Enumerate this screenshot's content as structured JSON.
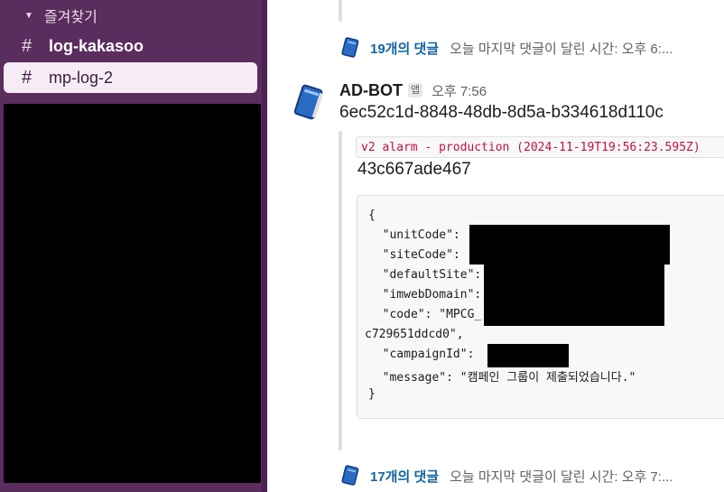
{
  "sidebar": {
    "section_label": "즐겨찾기",
    "channels": [
      {
        "hash": "#",
        "name": "log-kakasoo",
        "state": "unread"
      },
      {
        "hash": "#",
        "name": "mp-log-2",
        "state": "selected"
      }
    ]
  },
  "messages": {
    "thread_top": {
      "reply_count": "19개의 댓글",
      "last_reply": "오늘 마지막 댓글이 달린 시간: 오후 6:..."
    },
    "bot_message": {
      "sender": "AD-BOT",
      "badge": "앱",
      "time": "오후 7:56",
      "text": "6ec52c1d-8848-48db-8d5a-b334618d110c",
      "attachment": {
        "title_code": "v2 alarm - production (2024-11-19T19:56:23.595Z)",
        "subtitle": "43c667ade467",
        "code_lines": [
          "{",
          "  \"unitCode\":",
          "  \"siteCode\":",
          "  \"defaultSite\":",
          "  \"imwebDomain\":",
          "  \"code\": \"MPCG_",
          "c729651ddcd0\",",
          "  \"campaignId\":",
          "  \"message\": \"캠페인 그룹이 제출되었습니다.\"",
          "}"
        ]
      }
    },
    "thread_bottom": {
      "reply_count": "17개의 댓글",
      "last_reply": "오늘 마지막 댓글이 달린 시간: 오후 7:..."
    }
  },
  "colors": {
    "sidebar_bg": "#5b2c5e",
    "link_blue": "#1264a3",
    "code_red": "#c01343"
  }
}
